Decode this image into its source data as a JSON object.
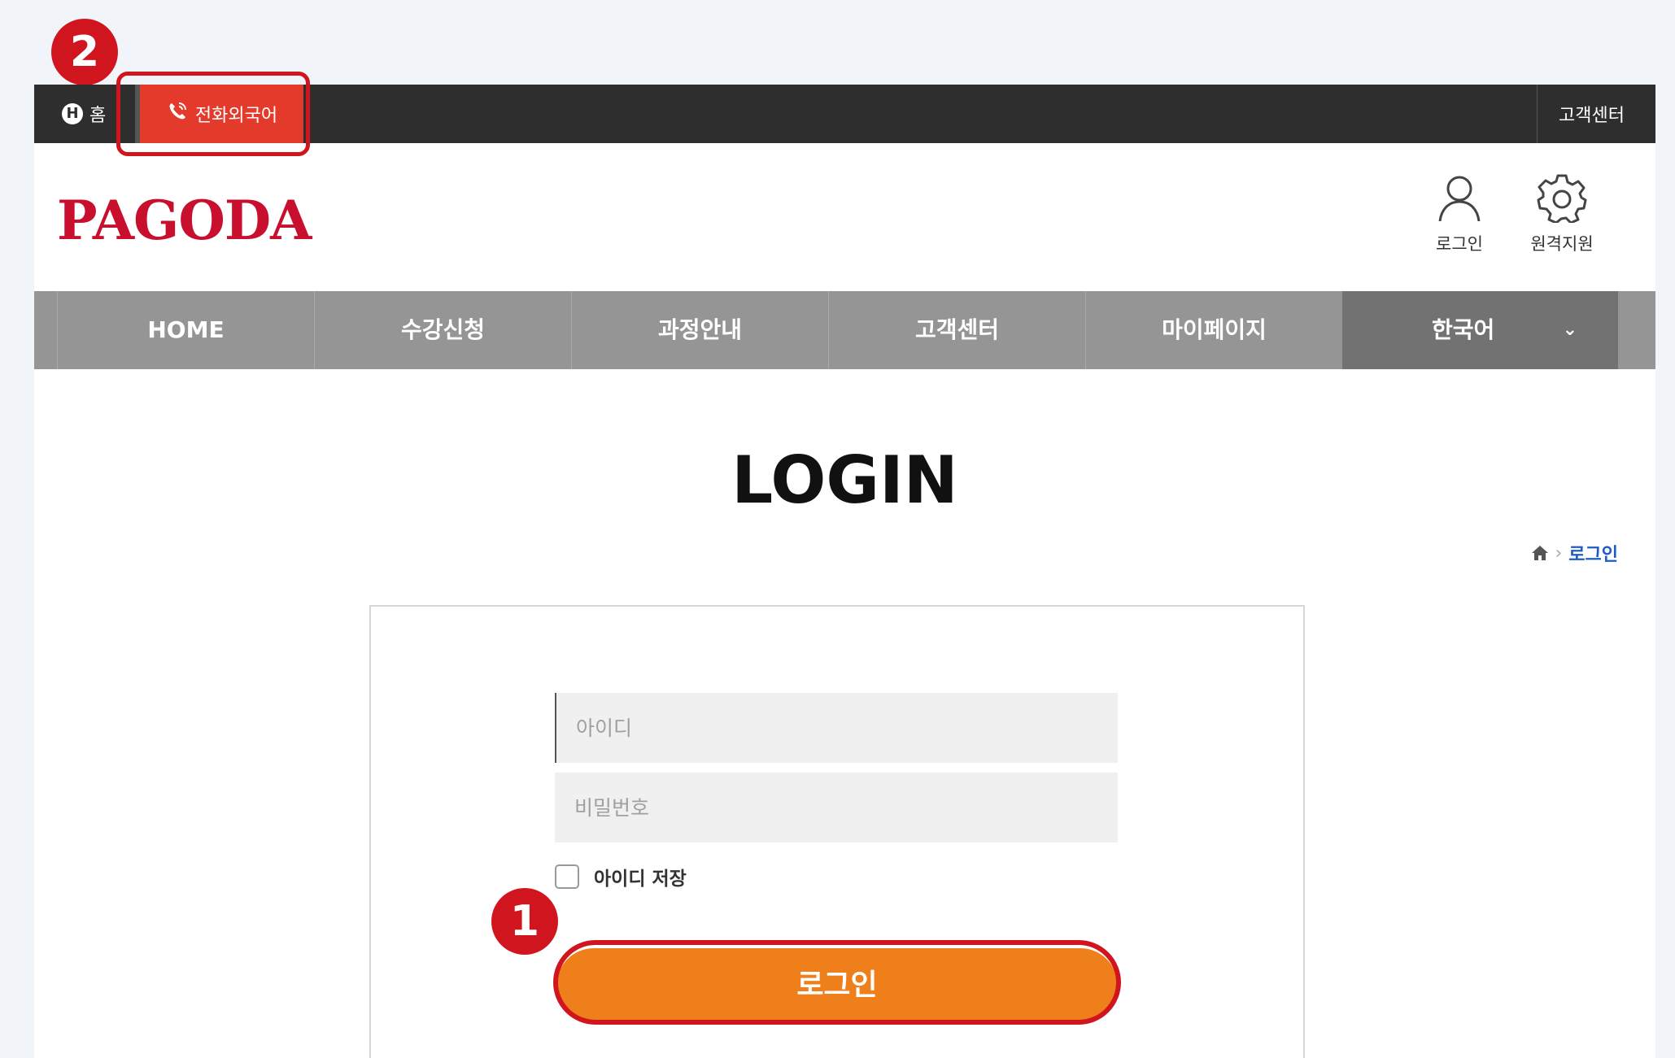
{
  "badges": {
    "one": "1",
    "two": "2"
  },
  "topbar": {
    "home_icon_letter": "H",
    "home_label": "홈",
    "phone_label": "전화외국어",
    "customer_center": "고객센터"
  },
  "header": {
    "logo": "PAGODA",
    "login_label": "로그인",
    "remote_label": "원격지원"
  },
  "nav": {
    "home": "HOME",
    "apply": "수강신청",
    "course": "과정안내",
    "customer_center": "고객센터",
    "mypage": "마이페이지",
    "language": "한국어"
  },
  "main": {
    "title": "LOGIN",
    "breadcrumb_current": "로그인"
  },
  "form": {
    "id_placeholder": "아이디",
    "pw_placeholder": "비밀번호",
    "remember_label": "아이디 저장",
    "submit_label": "로그인"
  },
  "colors": {
    "accent_orange": "#ef7f1a",
    "brand_red": "#c8102e",
    "callout_red": "#d0151f",
    "topbar_dark": "#2e2e2e",
    "nav_gray": "#959595"
  }
}
